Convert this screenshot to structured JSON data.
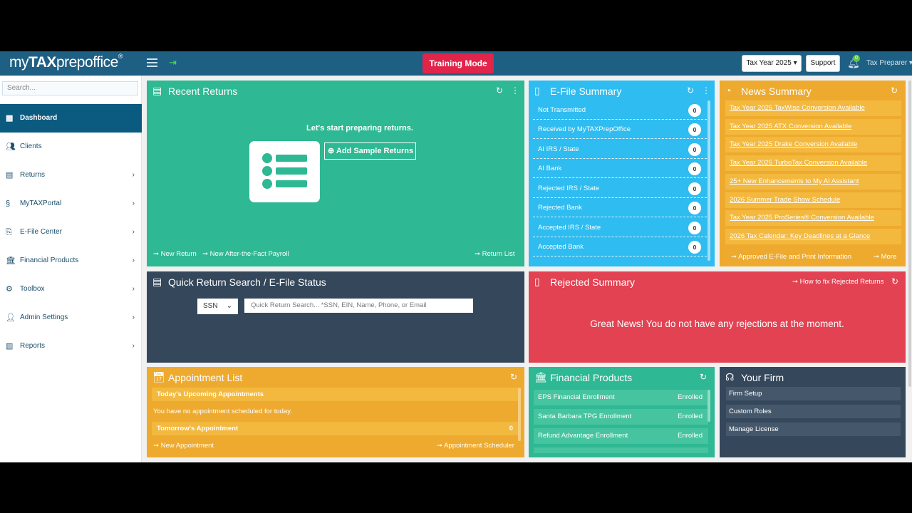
{
  "navbar": {
    "logo_my": "my",
    "logo_tax": "TAX",
    "logo_prep": "prepoffice",
    "logo_reg": "®",
    "training_mode": "Training Mode",
    "tax_year": "Tax Year 2025",
    "support": "Support",
    "bell_count": "0",
    "user": "Tax Preparer"
  },
  "sidebar": {
    "search_placeholder": "Search...",
    "items": [
      {
        "label": "Dashboard",
        "icon": "dashboard-icon"
      },
      {
        "label": "Clients",
        "icon": "users-icon"
      },
      {
        "label": "Returns",
        "icon": "returns-icon"
      },
      {
        "label": "MyTAXPortal",
        "icon": "portal-icon"
      },
      {
        "label": "E-File Center",
        "icon": "efile-icon"
      },
      {
        "label": "Financial Products",
        "icon": "bank-icon"
      },
      {
        "label": "Toolbox",
        "icon": "gear-icon"
      },
      {
        "label": "Admin Settings",
        "icon": "admin-icon"
      },
      {
        "label": "Reports",
        "icon": "reports-icon"
      }
    ]
  },
  "recent_returns": {
    "title": "Recent Returns",
    "message": "Let's start preparing returns.",
    "add_sample": "Add Sample Returns",
    "new_return": "New Return",
    "new_payroll": "New After-the-Fact Payroll",
    "return_list": "Return List"
  },
  "efile_summary": {
    "title": "E-File Summary",
    "rows": [
      {
        "label": "Not Transmitted",
        "count": "0"
      },
      {
        "label": "Received by MyTAXPrepOffice",
        "count": "0"
      },
      {
        "label": "AI IRS / State",
        "count": "0"
      },
      {
        "label": "AI Bank",
        "count": "0"
      },
      {
        "label": "Rejected IRS / State",
        "count": "0"
      },
      {
        "label": "Rejected Bank",
        "count": "0"
      },
      {
        "label": "Accepted IRS / State",
        "count": "0"
      },
      {
        "label": "Accepted Bank",
        "count": "0"
      }
    ]
  },
  "news_summary": {
    "title": "News Summary",
    "items": [
      "Tax Year 2025 TaxWise Conversion Available",
      "Tax Year 2025 ATX Conversion Available",
      "Tax Year 2025 Drake Conversion Available",
      "Tax Year 2025 TurboTax Conversion Available",
      "25+ New Enhancements to My AI Assistant",
      "2026 Summer Trade Show Schedule",
      "Tax Year 2025 ProSeries® Conversion Available",
      "2026 Tax Calendar: Key Deadlines at a Glance"
    ],
    "approved": "Approved E-File and Print Information",
    "more": "More"
  },
  "quick_search": {
    "title": "Quick Return Search / E-File Status",
    "select_value": "SSN",
    "placeholder": "Quick Return Search... *SSN, EIN, Name, Phone, or Email"
  },
  "rejected_summary": {
    "title": "Rejected Summary",
    "how_to_fix": "How to fix Rejected Returns",
    "message": "Great News! You do not have any rejections at the moment."
  },
  "appointments": {
    "title": "Appointment List",
    "today_header": "Today's Upcoming Appointments",
    "today_msg": "You have no appointment scheduled for today.",
    "tomorrow_header": "Tomorrow's Appointment",
    "tomorrow_count": "0",
    "new_appointment": "New Appointment",
    "scheduler": "Appointment Scheduler"
  },
  "financial_products": {
    "title": "Financial Products",
    "rows": [
      {
        "label": "EPS Financial Enrollment",
        "status": "Enrolled"
      },
      {
        "label": "Santa Barbara TPG Enrollment",
        "status": "Enrolled"
      },
      {
        "label": "Refund Advantage Enrollment",
        "status": "Enrolled"
      }
    ]
  },
  "your_firm": {
    "title": "Your Firm",
    "rows": [
      "Firm Setup",
      "Custom Roles",
      "Manage License"
    ]
  }
}
